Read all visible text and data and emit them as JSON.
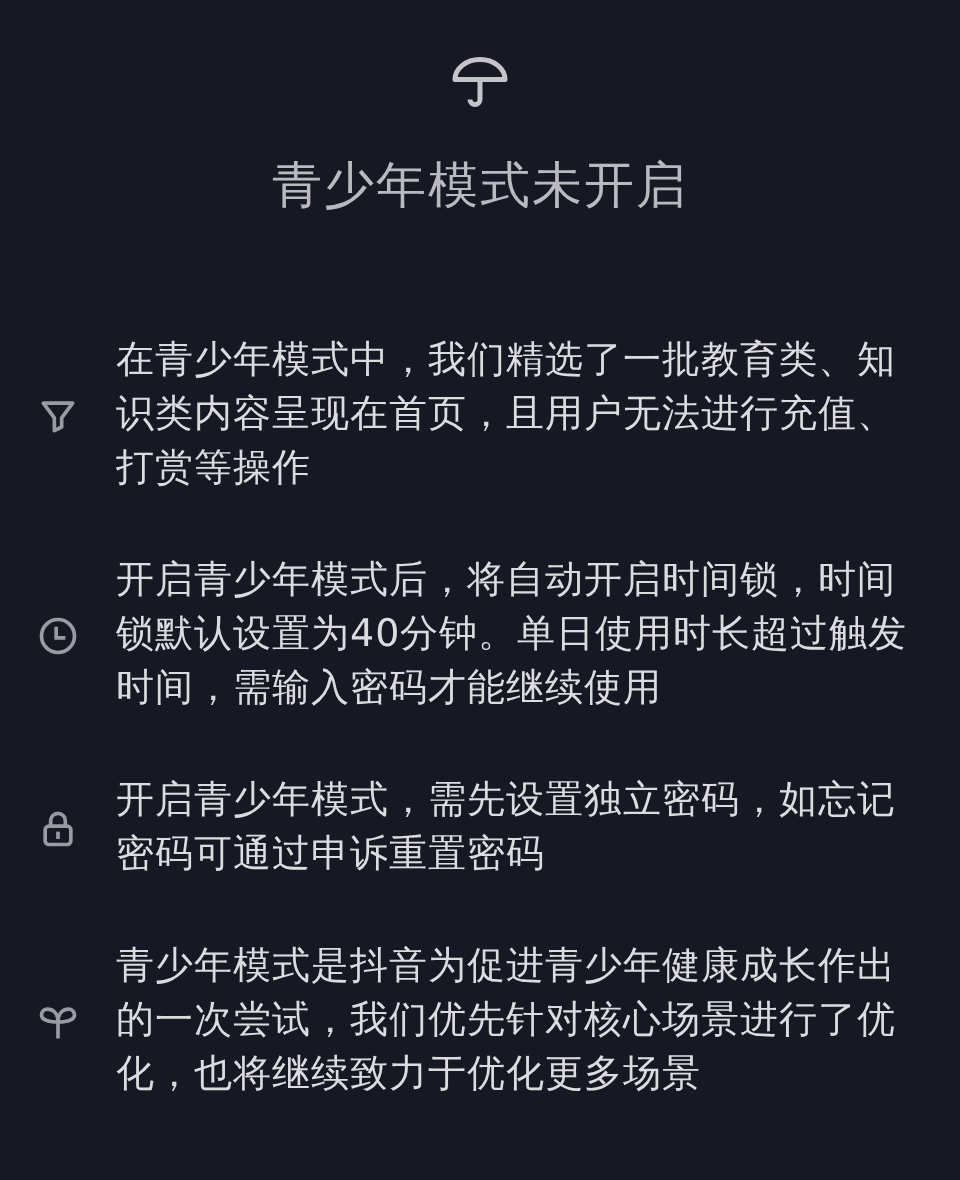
{
  "title": "青少年模式未开启",
  "items": [
    {
      "kind": "filter",
      "text": "在青少年模式中，我们精选了一批教育类、知识类内容呈现在首页，且用户无法进行充值、打赏等操作"
    },
    {
      "kind": "clock",
      "text": "开启青少年模式后，将自动开启时间锁，时间锁默认设置为40分钟。单日使用时长超过触发时间，需输入密码才能继续使用"
    },
    {
      "kind": "lock",
      "text": "开启青少年模式，需先设置独立密码，如忘记密码可通过申诉重置密码"
    },
    {
      "kind": "sprout",
      "text": "青少年模式是抖音为促进青少年健康成长作出的一次尝试，我们优先针对核心场景进行了优化，也将继续致力于优化更多场景"
    }
  ]
}
